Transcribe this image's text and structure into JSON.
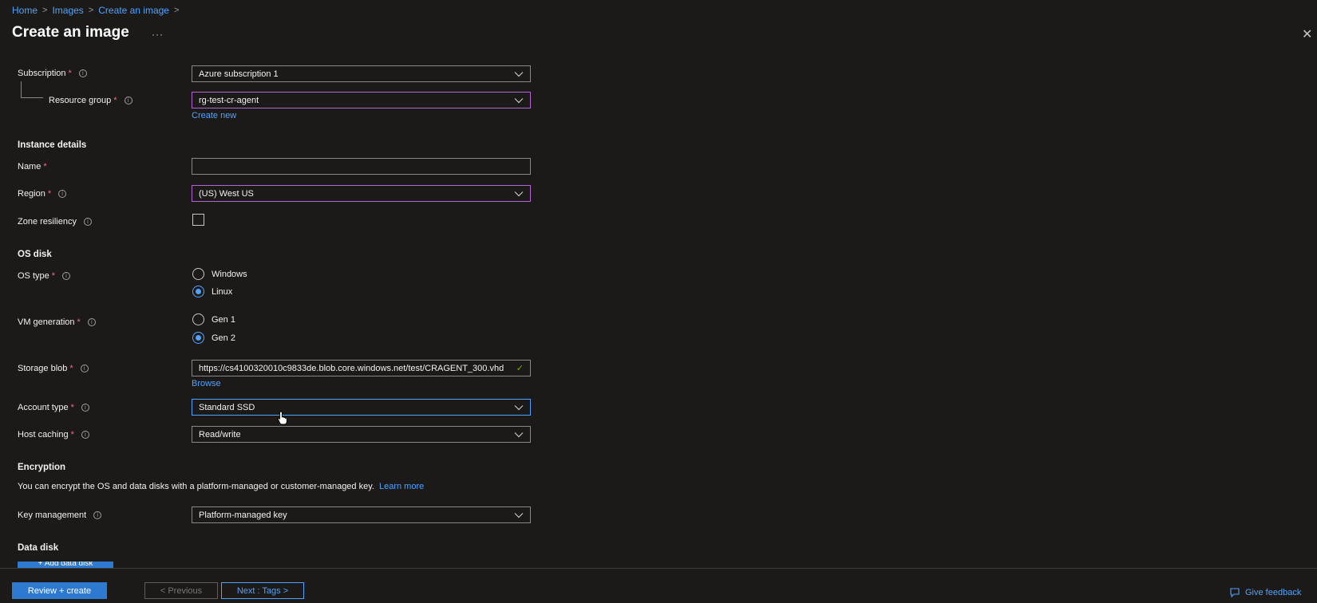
{
  "breadcrumb": {
    "home": "Home",
    "images": "Images",
    "current": "Create an image",
    "sep": ">"
  },
  "page": {
    "title": "Create an image",
    "more": "···",
    "close": "✕"
  },
  "subscription": {
    "label": "Subscription",
    "value": "Azure subscription 1"
  },
  "resource_group": {
    "label": "Resource group",
    "value": "rg-test-cr-agent",
    "create_new": "Create new"
  },
  "instance_details": {
    "heading": "Instance details"
  },
  "name": {
    "label": "Name",
    "value": ""
  },
  "region": {
    "label": "Region",
    "value": "(US) West US"
  },
  "zone_resiliency": {
    "label": "Zone resiliency",
    "checked": false
  },
  "os_disk": {
    "heading": "OS disk"
  },
  "os_type": {
    "label": "OS type",
    "options": [
      "Windows",
      "Linux"
    ],
    "selected": "Linux"
  },
  "vm_generation": {
    "label": "VM generation",
    "options": [
      "Gen 1",
      "Gen 2"
    ],
    "selected": "Gen 2"
  },
  "storage_blob": {
    "label": "Storage blob",
    "value": "https://cs4100320010c9833de.blob.core.windows.net/test/CRAGENT_300.vhd",
    "browse": "Browse"
  },
  "account_type": {
    "label": "Account type",
    "value": "Standard SSD"
  },
  "host_caching": {
    "label": "Host caching",
    "value": "Read/write"
  },
  "encryption": {
    "heading": "Encryption",
    "description": "You can encrypt the OS and data disks with a platform-managed or customer-managed key.",
    "learn_more": "Learn more"
  },
  "key_management": {
    "label": "Key management",
    "value": "Platform-managed key"
  },
  "data_disk": {
    "heading": "Data disk",
    "add_button": "+ Add data disk"
  },
  "footer": {
    "review_create": "Review + create",
    "previous": "< Previous",
    "next": "Next : Tags >",
    "feedback": "Give feedback"
  },
  "colors": {
    "accent": "#4fa3ff",
    "primary_button": "#2e7ad1",
    "required": "#f1707b",
    "highlight_border": "#b565d8",
    "background": "#1b1a19"
  }
}
